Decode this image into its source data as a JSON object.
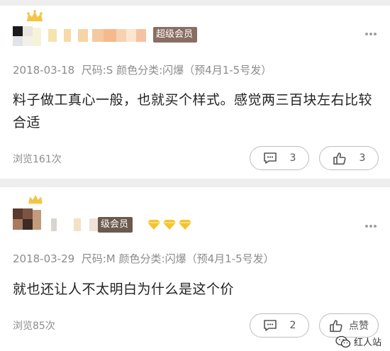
{
  "reviews": [
    {
      "badge": "超级会员",
      "date": "2018-03-18",
      "size": "尺码:S",
      "color": "颜色分类:闪爆",
      "presale": "（预4月1-5号发）",
      "comment": "料子做工真心一般，也就买个样式。感觉两三百块左右比较合适",
      "views": "浏览161次",
      "comments_count": "3",
      "likes_count": "3",
      "colors": {
        "badge_bg": "#8a6e63"
      }
    },
    {
      "badge": "级会员",
      "date": "2018-03-29",
      "size": "尺码:M",
      "color": "颜色分类:闪爆",
      "presale": "（预4月1-5号发）",
      "comment": "就也还让人不太明白为什么是这个价",
      "views": "浏览85次",
      "comments_count": "2",
      "likes_label": "点赞",
      "diamond_count": 3,
      "colors": {
        "badge_bg": "#6b5a4e",
        "diamond": "#f4c430"
      }
    }
  ],
  "watermark": {
    "text": "红人站"
  },
  "icons": [
    "crown-icon",
    "more-icon",
    "comment-icon",
    "thumbs-up-icon",
    "diamond-icon",
    "wechat-icon"
  ]
}
